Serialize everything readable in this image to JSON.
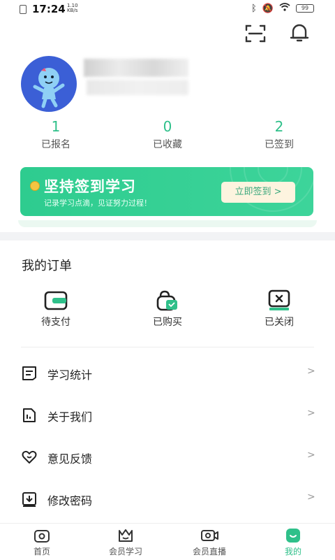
{
  "status_bar": {
    "time": "17:24",
    "net_speed": "1.10 KB/s",
    "battery": "99"
  },
  "profile": {
    "stats": [
      {
        "value": "1",
        "label": "已报名"
      },
      {
        "value": "0",
        "label": "已收藏"
      },
      {
        "value": "2",
        "label": "已签到"
      }
    ]
  },
  "banner": {
    "title": "坚持签到学习",
    "subtitle": "记录学习点滴，见证努力过程！",
    "button_label": "立即签到 >"
  },
  "orders": {
    "title": "我的订单",
    "items": [
      {
        "label": "待支付",
        "icon": "wallet-icon"
      },
      {
        "label": "已购买",
        "icon": "shopping-bag-icon"
      },
      {
        "label": "已关闭",
        "icon": "closed-box-icon"
      }
    ]
  },
  "menu": {
    "items": [
      {
        "label": "学习统计",
        "icon": "document-list-icon",
        "chevron": ">"
      },
      {
        "label": "关于我们",
        "icon": "info-file-icon",
        "chevron": ">"
      },
      {
        "label": "意见反馈",
        "icon": "heart-icon",
        "chevron": ">"
      },
      {
        "label": "修改密码",
        "icon": "download-box-icon",
        "chevron": ">"
      }
    ]
  },
  "tabbar": {
    "items": [
      {
        "label": "首页",
        "icon": "home-icon",
        "active": false
      },
      {
        "label": "会员学习",
        "icon": "crown-icon",
        "active": false
      },
      {
        "label": "会员直播",
        "icon": "video-icon",
        "active": false
      },
      {
        "label": "我的",
        "icon": "profile-icon",
        "active": true
      }
    ]
  },
  "colors": {
    "accent": "#2fc08a",
    "banner_button_bg": "#fdf4df"
  }
}
